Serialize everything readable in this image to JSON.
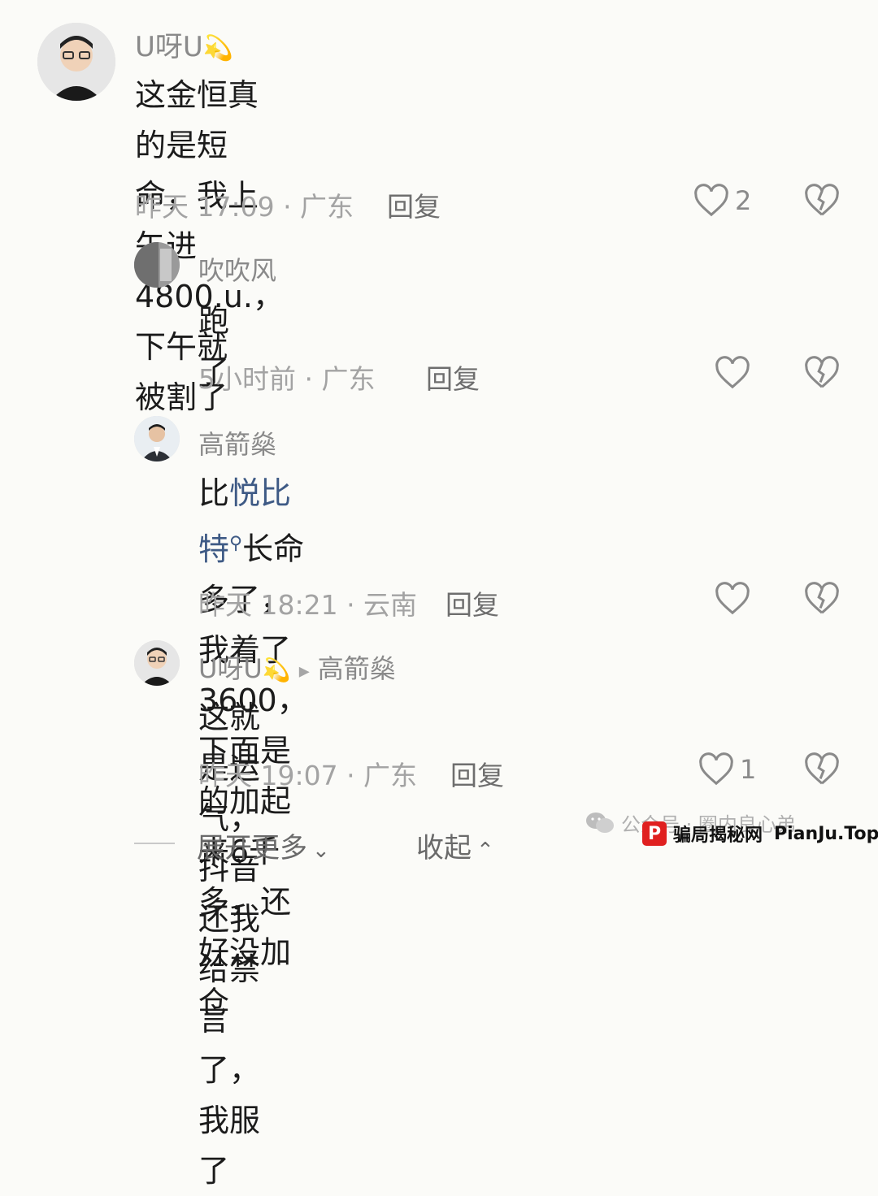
{
  "comments": [
    {
      "username": "U呀U",
      "username_emoji": "💫",
      "text": "这金恒真的是短命，我上午进4800.u.，下午就被割了",
      "text_line1": "这金恒真的是短命，我上午进4800.u.，下午就",
      "text_line2": "被割了",
      "meta": "昨天 17:09 · 广东",
      "reply": "回复",
      "likes": "2"
    },
    {
      "username": "吹吹风",
      "text": "跑了",
      "meta": "5小时前 · 广东",
      "reply": "回复",
      "likes": ""
    },
    {
      "username": "高箭燊",
      "text_pre": "比",
      "text_link": "悦比特",
      "text_post": "长命多了，我着了3600，下面是",
      "text_line2": "的加起来6千多，还好没加仓",
      "meta": "昨天 18:21 · 云南",
      "reply": "回复",
      "likes": ""
    },
    {
      "username": "U呀U",
      "username_emoji": "💫",
      "reply_to": "高箭燊",
      "text": "这就是运气，抖音还我给禁言了，我服了",
      "meta": "昨天 19:07 · 广东",
      "reply": "回复",
      "likes": "1"
    }
  ],
  "bottom": {
    "expand_more": "展开更多",
    "collapse": "收起"
  },
  "watermark": {
    "wechat_text": "公众号 · 圈内良心弟",
    "site_name": "骗局揭秘网",
    "site_domain": "PianJu.Top"
  }
}
